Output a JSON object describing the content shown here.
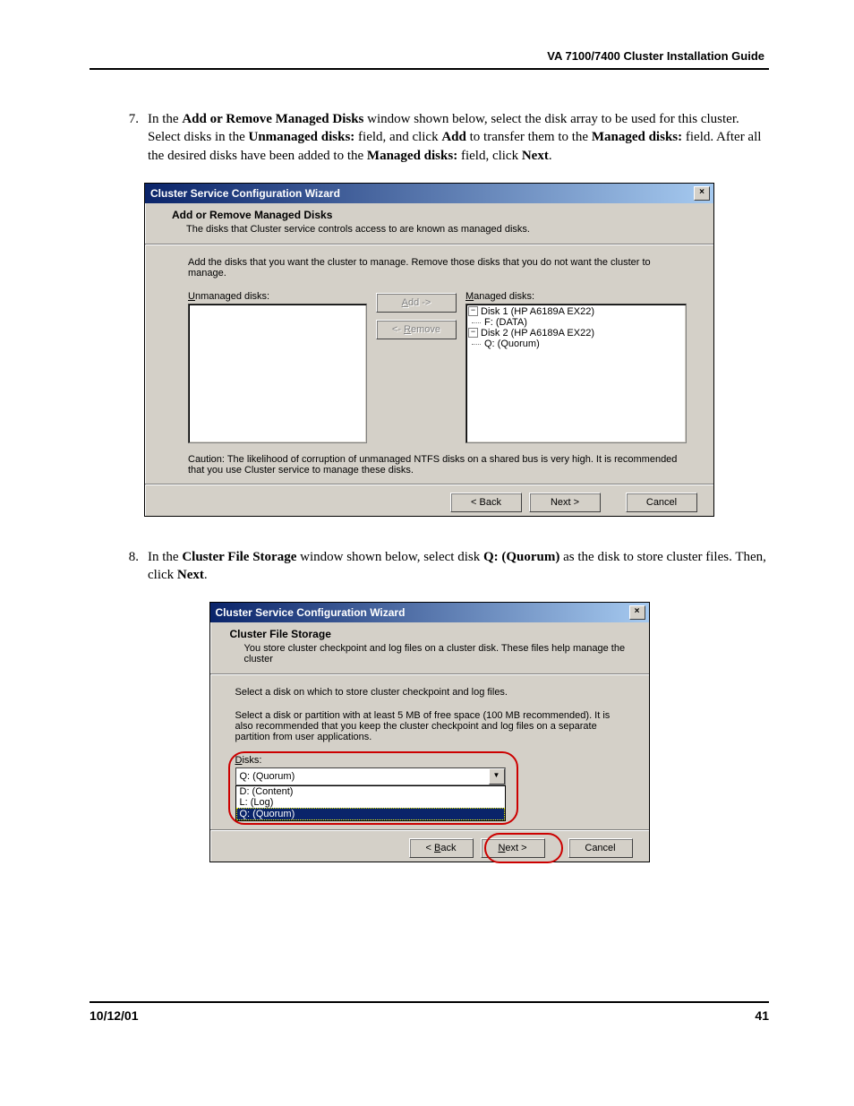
{
  "header": {
    "guide_title": "VA 7100/7400 Cluster Installation Guide"
  },
  "steps": {
    "s7": {
      "num": "7.",
      "html_parts": {
        "t1": "In the ",
        "b1": "Add or Remove Managed Disks",
        "t2": " window shown below, select the disk array to be used for this cluster.  Select disks in the ",
        "b2": "Unmanaged disks:",
        "t3": " field, and click ",
        "b3": "Add",
        "t4": " to transfer them to the ",
        "b4": "Managed disks:",
        "t5": " field.  After all the desired disks have been added to the ",
        "b5": "Managed disks:",
        "t6": " field, click ",
        "b6": "Next",
        "t7": "."
      }
    },
    "s8": {
      "num": "8.",
      "html_parts": {
        "t1": "In the ",
        "b1": "Cluster File Storage",
        "t2": " window shown below, select disk ",
        "b2": "Q: (Quorum)",
        "t3": " as the disk to store cluster files.  Then, click ",
        "b3": "Next",
        "t4": "."
      }
    }
  },
  "dialog1": {
    "title": "Cluster Service Configuration Wizard",
    "heading": "Add or Remove Managed Disks",
    "desc": "The disks that Cluster service controls access to are known as managed disks.",
    "instr": "Add the disks that you want the cluster to manage. Remove those disks that you do not want the cluster to manage.",
    "unmanaged_lbl_pre": "U",
    "unmanaged_lbl": "nmanaged disks:",
    "managed_lbl_pre": "M",
    "managed_lbl": "anaged disks:",
    "add_btn_pre": "A",
    "add_btn": "dd ->",
    "remove_btn": "<- ",
    "remove_btn_mid": "R",
    "remove_btn_post": "emove",
    "tree": {
      "d1": "Disk 1 (HP A6189A EX22)",
      "d1a": "F: (DATA)",
      "d2": "Disk 2 (HP A6189A EX22)",
      "d2a": "Q: (Quorum)"
    },
    "caution": "Caution: The likelihood of corruption of unmanaged NTFS disks on a shared bus is very high. It is recommended that you use Cluster service to manage these disks.",
    "back": "< Back",
    "next": "Next >",
    "cancel": "Cancel"
  },
  "dialog2": {
    "title": "Cluster Service Configuration Wizard",
    "heading": "Cluster File Storage",
    "desc": "You store cluster checkpoint and log files on a cluster disk. These files help manage the cluster",
    "instr1": "Select a disk on which to store cluster checkpoint and log files.",
    "instr2": "Select a disk or partition with at least 5 MB of free space (100 MB recommended). It is also recommended that you keep the cluster checkpoint and log files on a separate partition from user applications.",
    "disks_lbl_pre": "D",
    "disks_lbl": "isks:",
    "selected": "Q: (Quorum)",
    "opt1": "D: (Content)",
    "opt2": "L: (Log)",
    "opt3": "Q: (Quorum)",
    "back_pre": "< ",
    "back_u": "B",
    "back_post": "ack",
    "next_u": "N",
    "next_post": "ext >",
    "cancel": "Cancel"
  },
  "footer": {
    "date": "10/12/01",
    "page": "41"
  }
}
